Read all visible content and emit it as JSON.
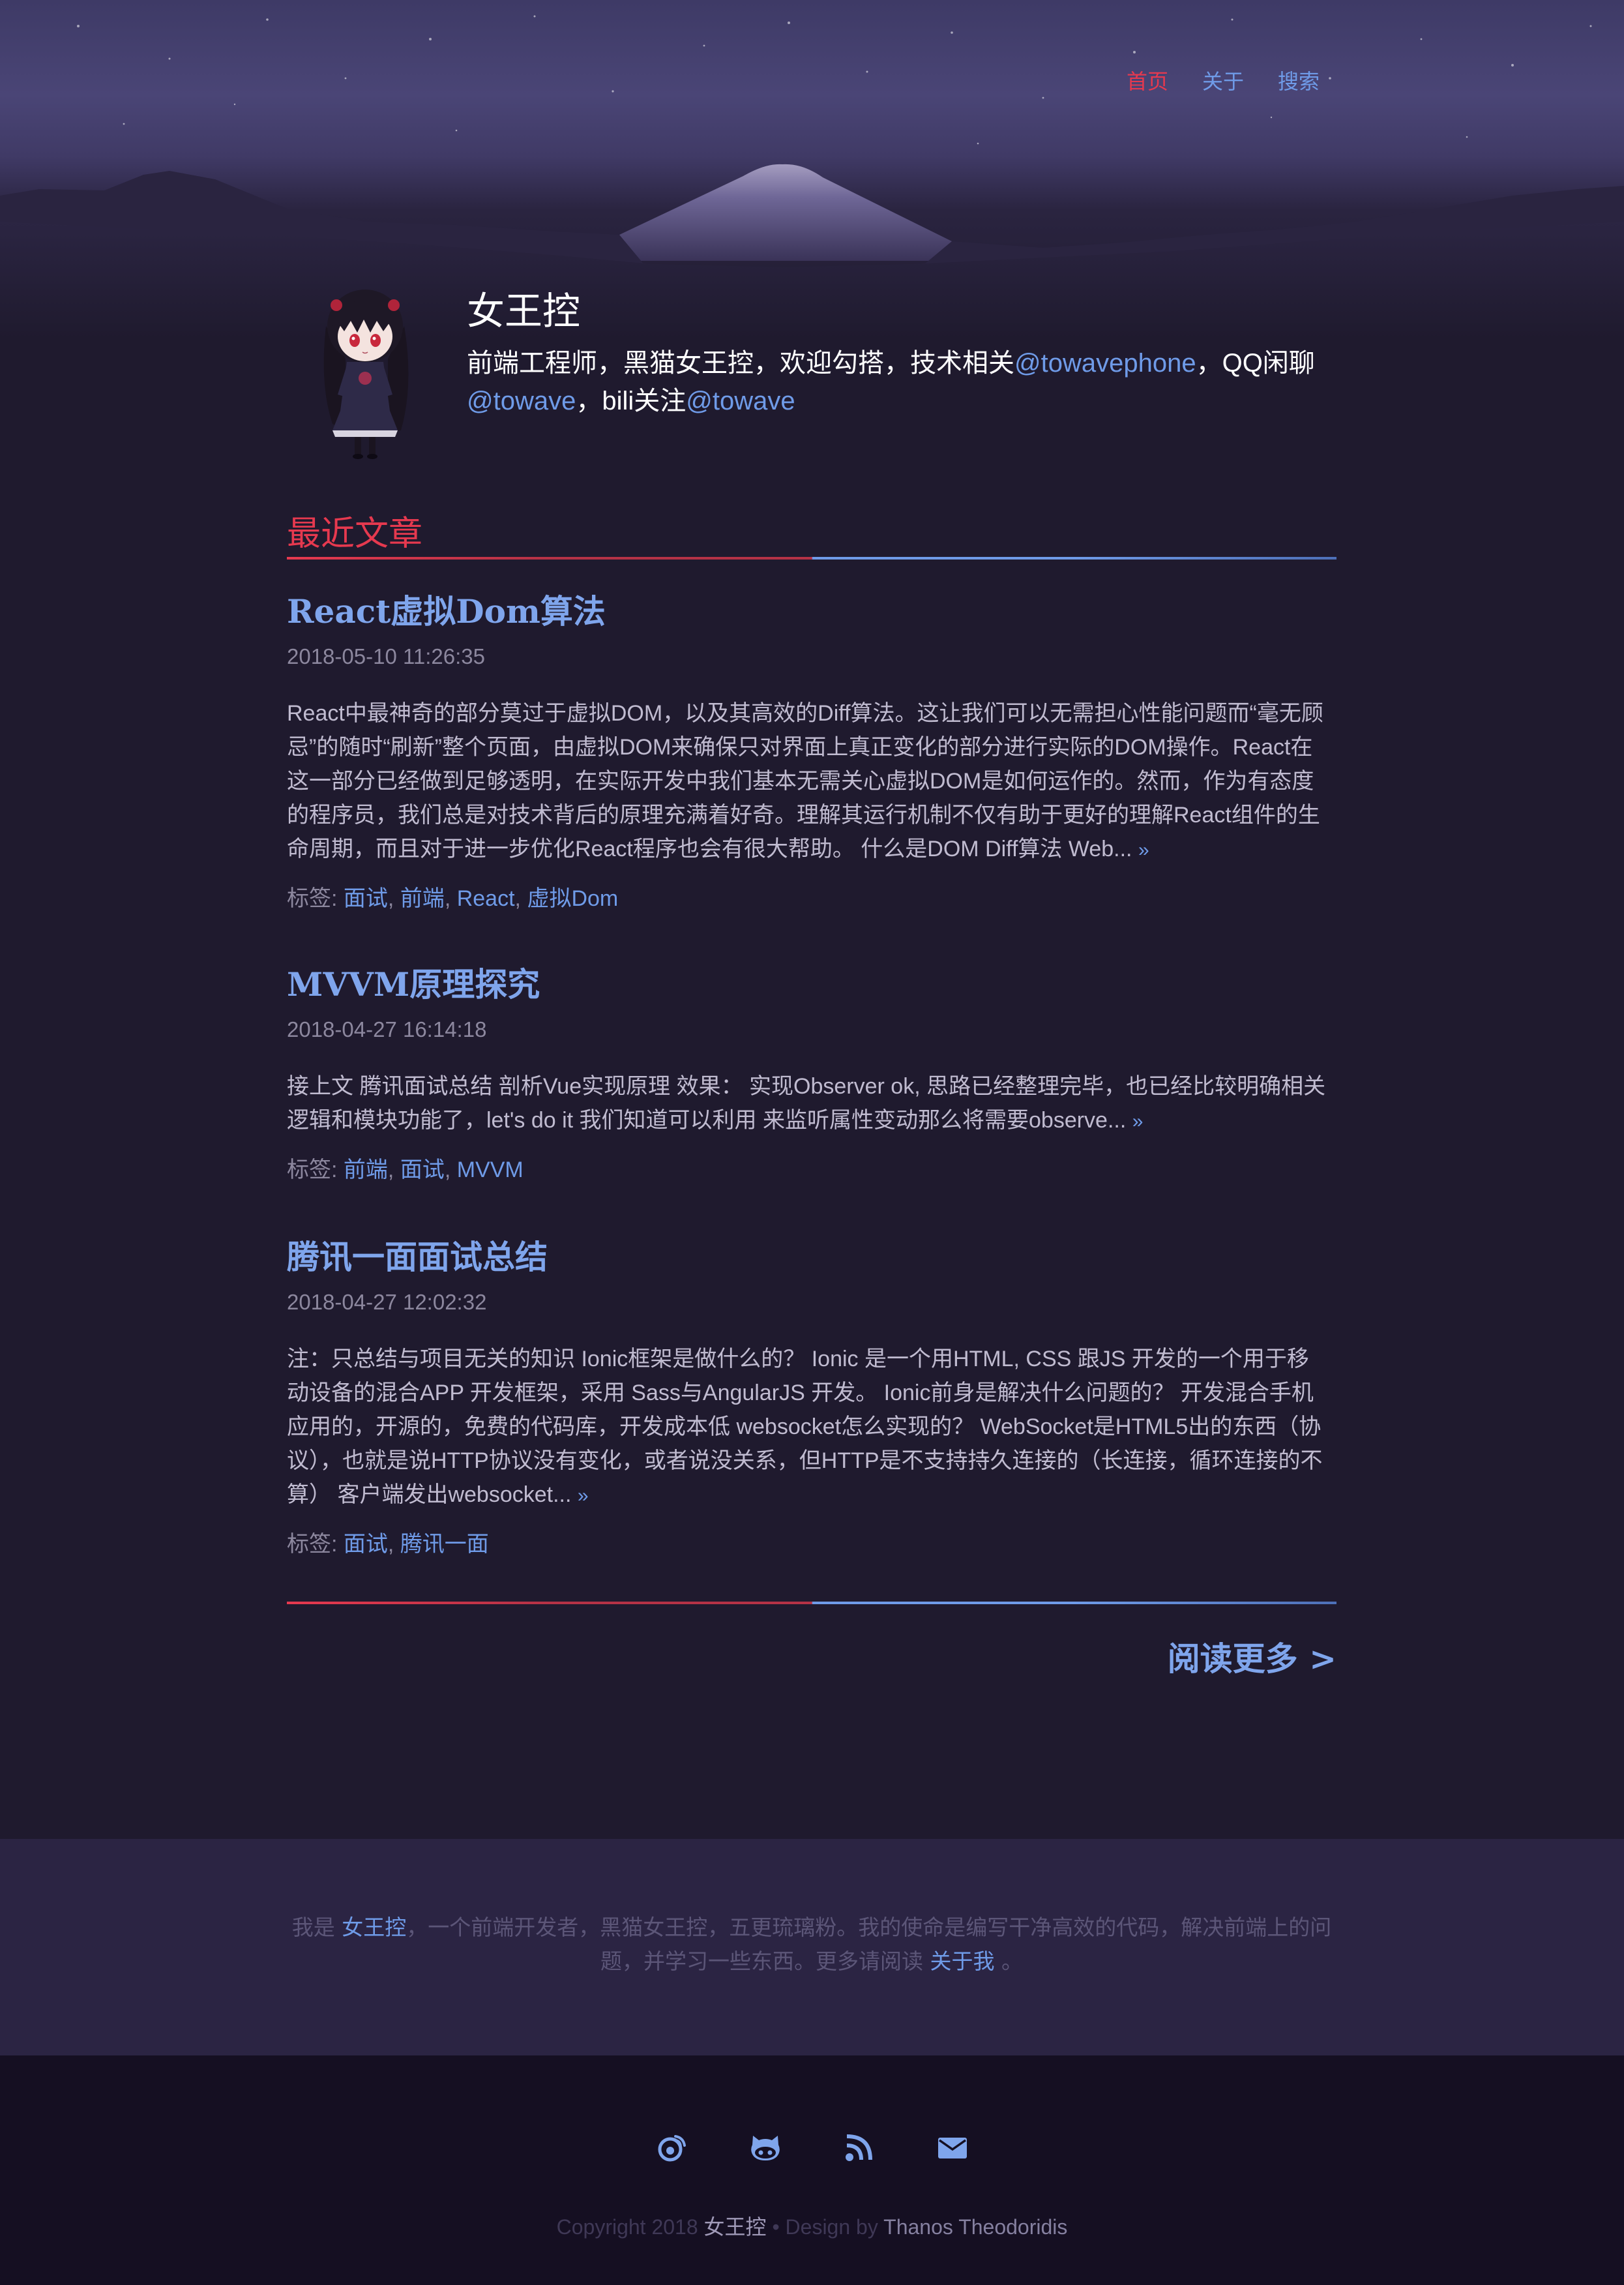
{
  "nav": {
    "items": [
      {
        "label": "首页",
        "active": true
      },
      {
        "label": "关于",
        "active": false
      },
      {
        "label": "搜索",
        "active": false
      }
    ]
  },
  "profile": {
    "name": "女王控",
    "bio_prefix": "前端工程师，黑猫女王控，欢迎勾搭，技术相关",
    "bio_link1": "@towavephone",
    "bio_mid": "，QQ闲聊",
    "bio_link2": "@towave",
    "bio_mid2": "，bili关注",
    "bio_link3": "@towave"
  },
  "section": {
    "title": "最近文章"
  },
  "posts": [
    {
      "title": "React虚拟Dom算法",
      "date": "2018-05-10 11:26:35",
      "excerpt": "React中最神奇的部分莫过于虚拟DOM，以及其高效的Diff算法。这让我们可以无需担心性能问题而“毫无顾忌”的随时“刷新”整个页面，由虚拟DOM来确保只对界面上真正变化的部分进行实际的DOM操作。React在这一部分已经做到足够透明，在实际开发中我们基本无需关心虚拟DOM是如何运作的。然而，作为有态度的程序员，我们总是对技术背后的原理充满着好奇。理解其运行机制不仅有助于更好的理解React组件的生命周期，而且对于进一步优化React程序也会有很大帮助。 什么是DOM Diff算法 Web...",
      "more": "»",
      "tags_label": "标签: ",
      "tags": [
        "面试",
        "前端",
        "React",
        "虚拟Dom"
      ]
    },
    {
      "title": "MVVM原理探究",
      "date": "2018-04-27 16:14:18",
      "excerpt": "接上文 腾讯面试总结 剖析Vue实现原理 效果： 实现Observer ok, 思路已经整理完毕，也已经比较明确相关逻辑和模块功能了，let's do it 我们知道可以利用 来监听属性变动那么将需要observe...",
      "more": "»",
      "tags_label": "标签: ",
      "tags": [
        "前端",
        "面试",
        "MVVM"
      ]
    },
    {
      "title": "腾讯一面面试总结",
      "date": "2018-04-27 12:02:32",
      "excerpt": "注：只总结与项目无关的知识 Ionic框架是做什么的？ Ionic 是一个用HTML, CSS 跟JS 开发的一个用于移动设备的混合APP 开发框架，采用 Sass与AngularJS 开发。 Ionic前身是解决什么问题的？ 开发混合手机应用的，开源的，免费的代码库，开发成本低 websocket怎么实现的？ WebSocket是HTML5出的东西（协议），也就是说HTTP协议没有变化，或者说没关系，但HTTP是不支持持久连接的（长连接，循环连接的不算） 客户端发出websocket...",
      "more": "»",
      "tags_label": "标签: ",
      "tags": [
        "面试",
        "腾讯一面"
      ]
    }
  ],
  "read_more": "阅读更多 >",
  "about": {
    "prefix": "我是 ",
    "name": "女王控",
    "body": "，一个前端开发者，黑猫女王控，五更琉璃粉。我的使命是编写干净高效的代码，解决前端上的问题，并学习一些东西。更多请阅读 ",
    "link": "关于我",
    "suffix": " 。"
  },
  "footer": {
    "icons": [
      "weibo-icon",
      "github-icon",
      "rss-icon",
      "mail-icon"
    ],
    "copyright_prefix": "Copyright 2018 ",
    "copyright_name": "女王控",
    "copyright_mid": " • Design by ",
    "copyright_designer": "Thanos Theodoridis"
  },
  "colors": {
    "accent_red": "#e6394f",
    "accent_blue": "#6f9be8",
    "background": "#1f1a2e"
  }
}
